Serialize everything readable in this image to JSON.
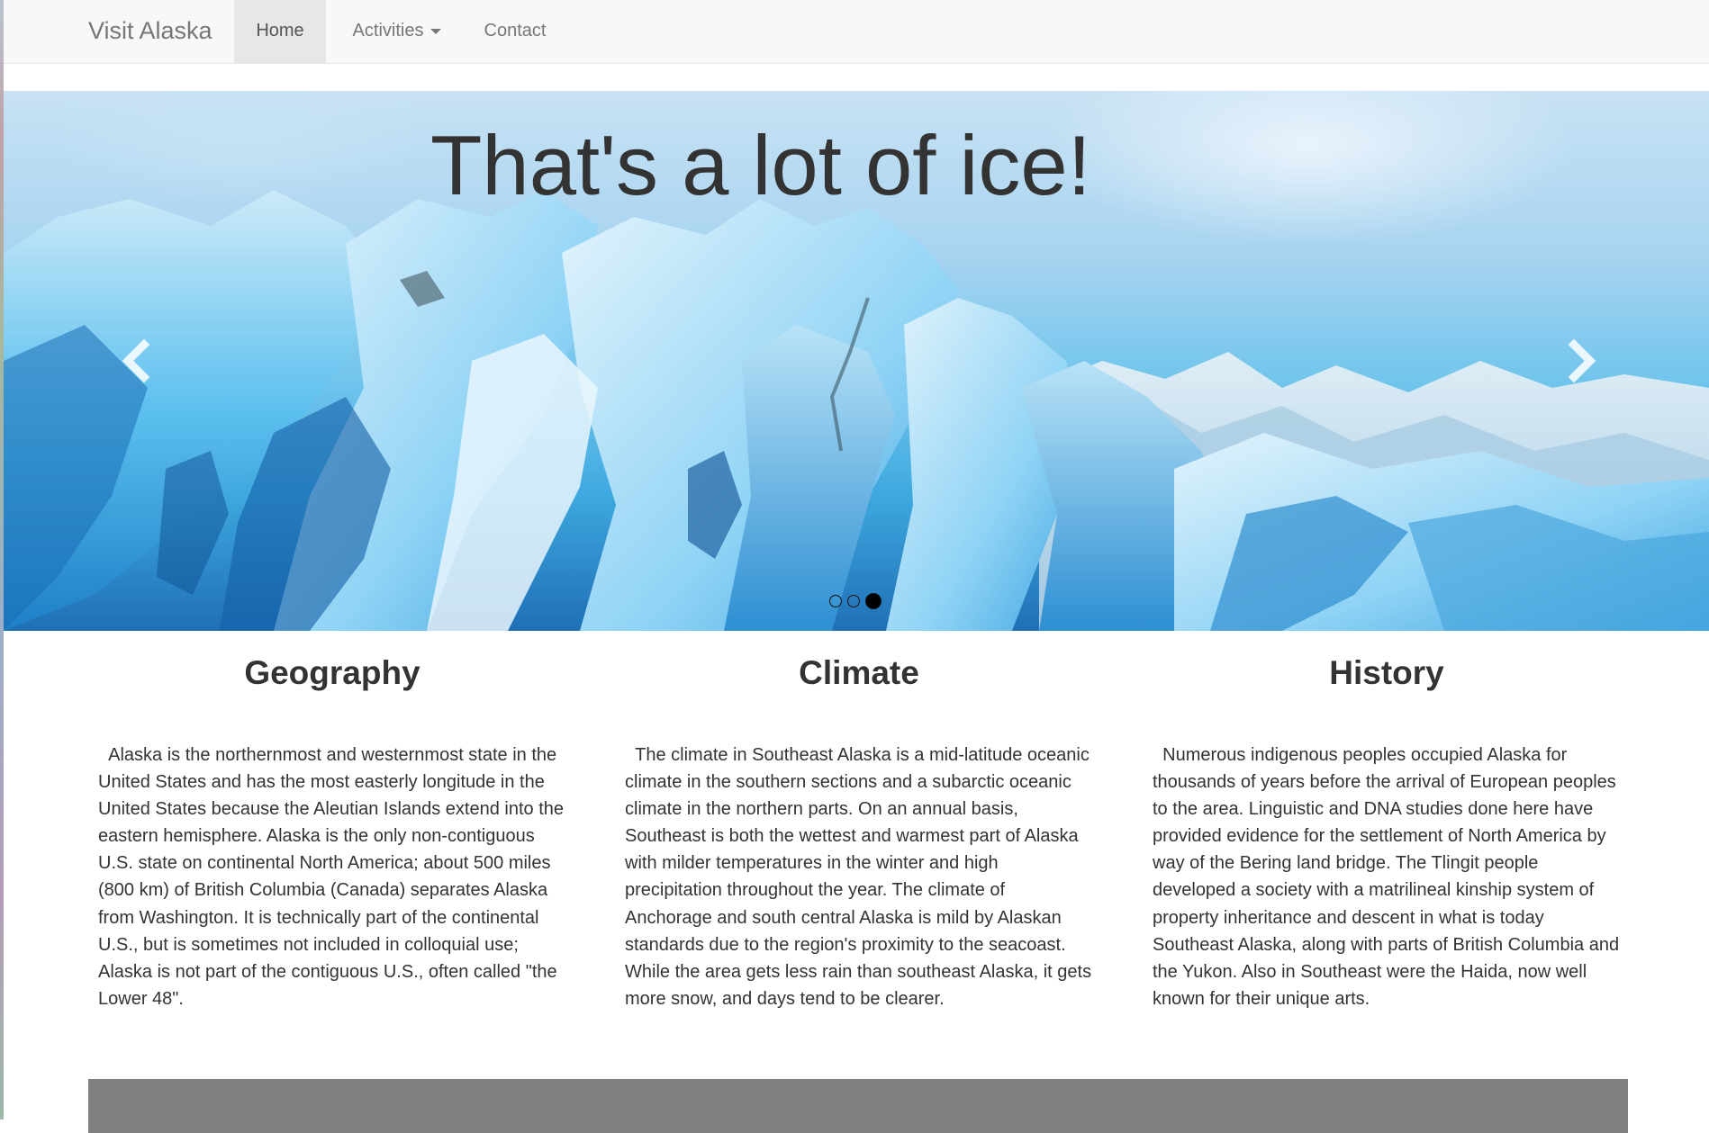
{
  "navbar": {
    "brand": "Visit Alaska",
    "items": [
      {
        "label": "Home",
        "active": true
      },
      {
        "label": "Activities",
        "dropdown": true
      },
      {
        "label": "Contact"
      }
    ]
  },
  "carousel": {
    "caption": "That's a lot of ice!",
    "slide_count": 3,
    "active_slide": 3,
    "prev_icon": "chevron-left-icon",
    "next_icon": "chevron-right-icon"
  },
  "sections": [
    {
      "title": "Geography",
      "text": "Alaska is the northernmost and westernmost state in the United States and has the most easterly longitude in the United States because the Aleutian Islands extend into the eastern hemisphere. Alaska is the only non-contiguous U.S. state on continental North America; about 500 miles (800 km) of British Columbia (Canada) separates Alaska from Washington. It is technically part of the continental U.S., but is sometimes not included in colloquial use; Alaska is not part of the contiguous U.S., often called \"the Lower 48\"."
    },
    {
      "title": "Climate",
      "text": "The climate in Southeast Alaska is a mid-latitude oceanic climate in the southern sections and a subarctic oceanic climate in the northern parts. On an annual basis, Southeast is both the wettest and warmest part of Alaska with milder temperatures in the winter and high precipitation throughout the year. The climate of Anchorage and south central Alaska is mild by Alaskan standards due to the region's proximity to the seacoast. While the area gets less rain than southeast Alaska, it gets more snow, and days tend to be clearer."
    },
    {
      "title": "History",
      "text": "Numerous indigenous peoples occupied Alaska for thousands of years before the arrival of European peoples to the area. Linguistic and DNA studies done here have provided evidence for the settlement of North America by way of the Bering land bridge. The Tlingit people developed a society with a matrilineal kinship system of property inheritance and descent in what is today Southeast Alaska, along with parts of British Columbia and the Yukon. Also in Southeast were the Haida, now well known for their unique arts."
    }
  ],
  "colors": {
    "navbar_bg": "#f8f8f8",
    "active_nav_bg": "#e7e7e7",
    "text": "#333333",
    "muted_text": "#777777",
    "footer_band": "#808080"
  }
}
